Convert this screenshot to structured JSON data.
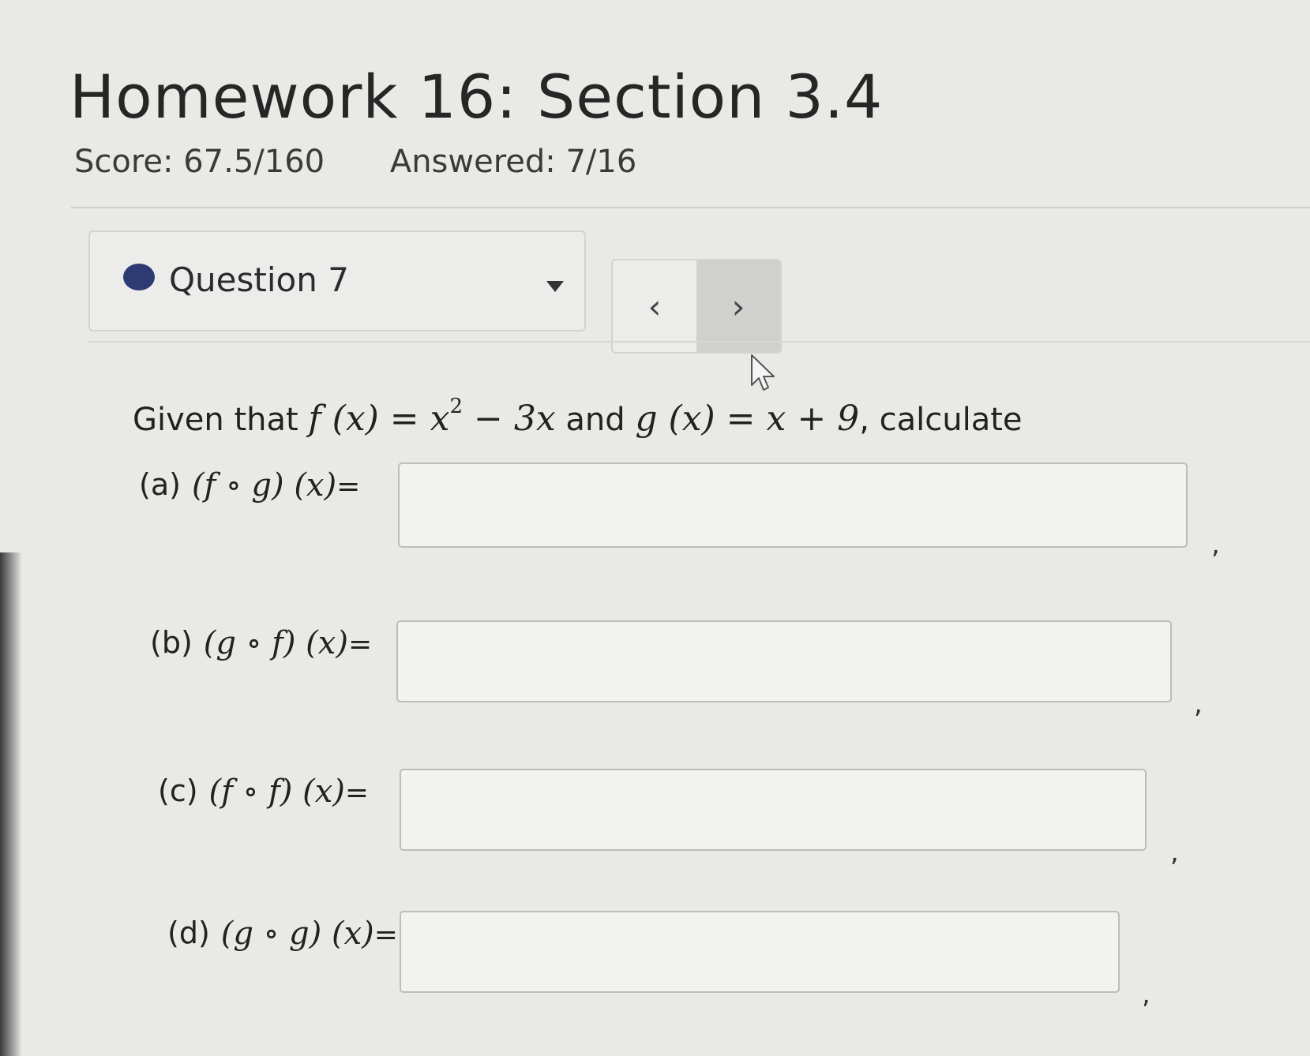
{
  "header": {
    "title": "Homework 16: Section 3.4",
    "score": "Score: 67.5/160",
    "answered": "Answered: 7/16"
  },
  "question_nav": {
    "label": "Question 7",
    "prev": "‹",
    "next": "›"
  },
  "problem": {
    "prefix": "Given that",
    "f_def": "f (x) = x",
    "f_exp": "2",
    "f_rest": " − 3x",
    "joiner": "and",
    "g_def": "g (x) = x + 9",
    "suffix": ", calculate"
  },
  "parts": [
    {
      "label": "(a)",
      "expr": "(f ∘ g) (x)",
      "eq": "=",
      "value": "",
      "comma": ","
    },
    {
      "label": "(b)",
      "expr": "(g ∘ f) (x)",
      "eq": "=",
      "value": "",
      "comma": ","
    },
    {
      "label": "(c)",
      "expr": "(f ∘ f) (x)",
      "eq": "=",
      "value": "",
      "comma": ","
    },
    {
      "label": "(d)",
      "expr": "(g ∘ g) (x)",
      "eq": "=",
      "value": "",
      "comma": ","
    }
  ],
  "colors": {
    "status_dot": "#2d3b72",
    "background": "#e9e9e6"
  }
}
